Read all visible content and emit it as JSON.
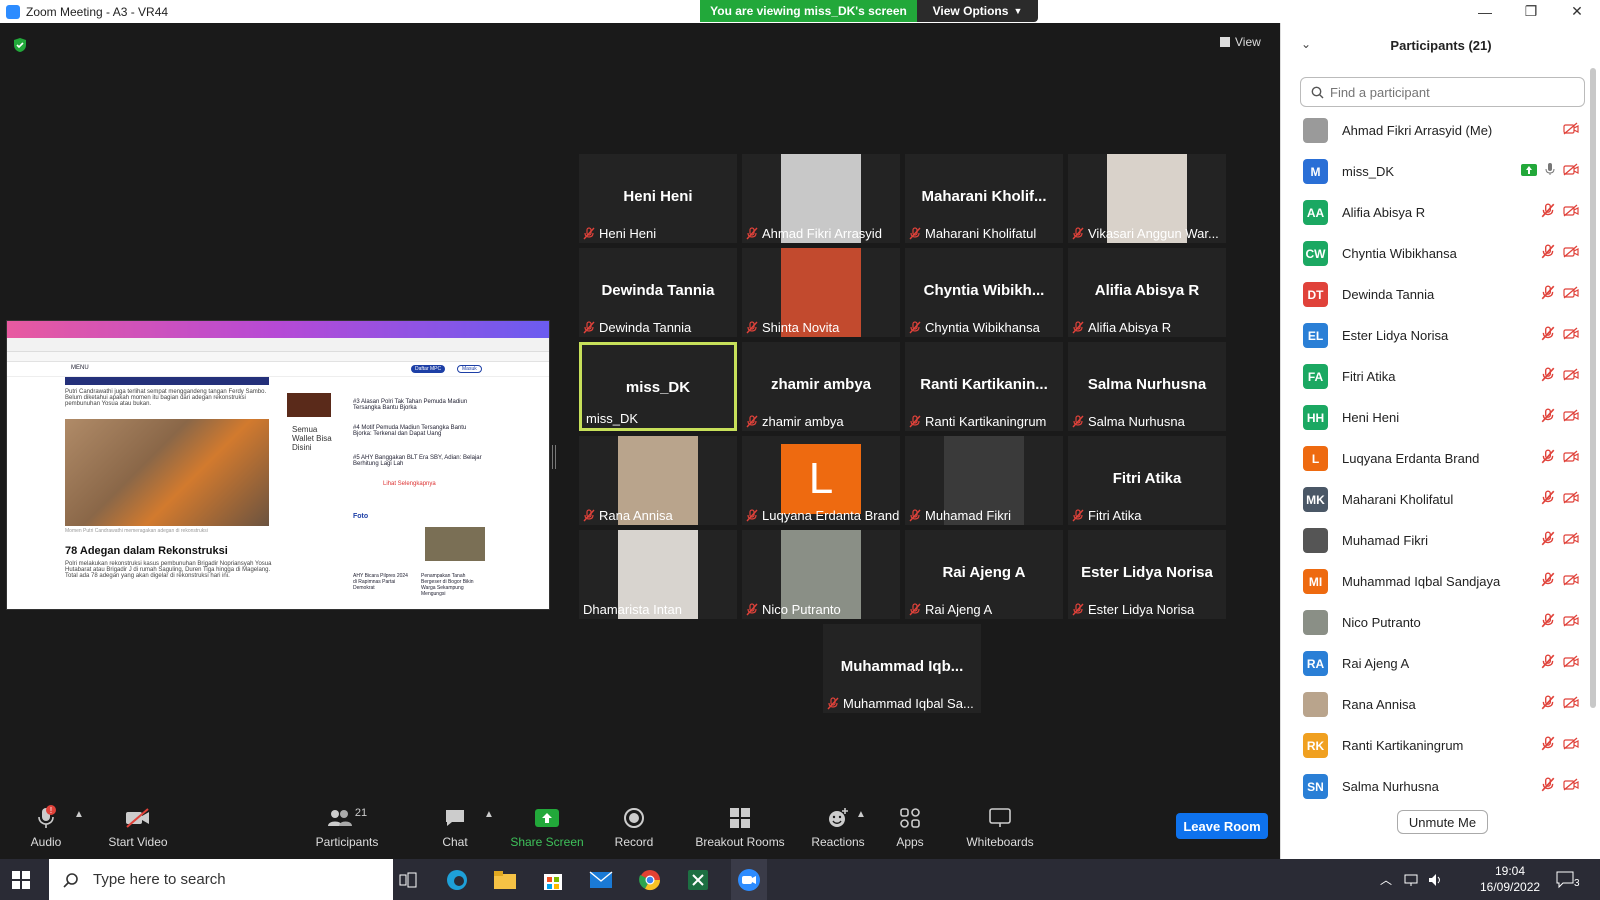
{
  "window": {
    "title": "Zoom Meeting - A3 - VR44",
    "minimize": "—",
    "maximize": "❐",
    "close": "✕"
  },
  "share_banner": {
    "text": "You are viewing miss_DK's screen",
    "view_options": "View Options"
  },
  "view_button": {
    "label": "View"
  },
  "shared_screen": {
    "headline": "78 Adegan dalam Rekonstruksi",
    "para1": "Putri Candrawathi juga terlihat sempat menggandeng tangan Ferdy Sambo. Belum diketahui apakah momen itu bagian dari adegan rekonstruksi pembunuhan Yosua atau bukan.",
    "para2": "Polri melakukan rekonstruksi kasus pembunuhan Brigadir Nopriansyah Yosua Hutabarat atau Brigadir J di rumah Saguling, Duren Tiga hingga di Magelang. Total ada 78 adegan yang akan digelar di rekonstruksi hari ini.",
    "side_items": [
      "#3 Alasan Polri Tak Tahan Pemuda Madiun Tersangka Bantu Bjorka",
      "#4 Motif Pemuda Madiun Tersangka Bantu Bjorka: Terkenal dan Dapat Uang",
      "#5 AHY Banggakan BLT Era SBY, Adian: Belajar Berhitung Lagi Lah"
    ],
    "side_link": "Lihat Selengkapnya",
    "foto_label": "Foto",
    "wallet_text": "Semua Wallet Bisa Disini",
    "menu_label": "MENU",
    "daftar_label": "Daftar MPC",
    "masuk_label": "Masuk",
    "caption": "Momen Putri Candrawathi memeragakan adegan di rekonstruksi",
    "foto_item1": "AHY Bicara Pilpres 2024 di Rapimnas Partai Demokrat",
    "foto_item2": "Penampakan Tanah Bergeser di Bogor Bikin Warga Sekampung Mengungsi"
  },
  "tiles": [
    {
      "name": "Heni Heni",
      "label": "Heni Heni",
      "muted": true,
      "photo": false
    },
    {
      "name": "",
      "label": "Ahmad Fikri Arrasyid",
      "muted": true,
      "photo": true,
      "photo_color": "#c8c8c8"
    },
    {
      "name": "Maharani Kholif...",
      "label": "Maharani Kholifatul",
      "muted": true,
      "photo": false
    },
    {
      "name": "",
      "label": "Vikasari Anggun War...",
      "muted": true,
      "photo": true,
      "photo_color": "#d9d2ca"
    },
    {
      "name": "Dewinda Tannia",
      "label": "Dewinda Tannia",
      "muted": true,
      "photo": false
    },
    {
      "name": "",
      "label": "Shinta Novita",
      "muted": true,
      "photo": true,
      "photo_color": "#c24a2e"
    },
    {
      "name": "Chyntia Wibikh...",
      "label": "Chyntia Wibikhansa",
      "muted": true,
      "photo": false
    },
    {
      "name": "Alifia Abisya R",
      "label": "Alifia Abisya R",
      "muted": true,
      "photo": false
    },
    {
      "name": "miss_DK",
      "label": "miss_DK",
      "muted": false,
      "photo": false,
      "active": true
    },
    {
      "name": "zhamir ambya",
      "label": "zhamir ambya",
      "muted": true,
      "photo": false
    },
    {
      "name": "Ranti Kartikanin...",
      "label": "Ranti Kartikaningrum",
      "muted": true,
      "photo": false
    },
    {
      "name": "Salma Nurhusna",
      "label": "Salma Nurhusna",
      "muted": true,
      "photo": false
    },
    {
      "name": "",
      "label": "Rana Annisa",
      "muted": true,
      "photo": true,
      "photo_color": "#b9a48c"
    },
    {
      "name": "",
      "label": "Luqyana Erdanta Brand",
      "muted": true,
      "photo": true,
      "photo_color": "#ee6a10",
      "letter": "L"
    },
    {
      "name": "",
      "label": "Muhamad Fikri",
      "muted": true,
      "photo": true,
      "photo_color": "#3a3a3a"
    },
    {
      "name": "Fitri Atika",
      "label": "Fitri Atika",
      "muted": true,
      "photo": false
    },
    {
      "name": "",
      "label": "Dhamarista Intan",
      "muted": false,
      "photo": true,
      "photo_color": "#d8d4cf"
    },
    {
      "name": "",
      "label": "Nico Putranto",
      "muted": true,
      "photo": true,
      "photo_color": "#8a8f86"
    },
    {
      "name": "Rai Ajeng A",
      "label": "Rai Ajeng A",
      "muted": true,
      "photo": false
    },
    {
      "name": "Ester Lidya Norisa",
      "label": "Ester Lidya Norisa",
      "muted": true,
      "photo": false
    },
    {
      "name": "Muhammad Iqb...",
      "label": "Muhammad Iqbal Sa...",
      "muted": true,
      "photo": false
    }
  ],
  "toolbar": {
    "audio": "Audio",
    "audio_badge": "!",
    "start_video": "Start Video",
    "participants": "Participants",
    "participants_count": "21",
    "chat": "Chat",
    "share_screen": "Share Screen",
    "record": "Record",
    "breakout_rooms": "Breakout Rooms",
    "reactions": "Reactions",
    "apps": "Apps",
    "whiteboards": "Whiteboards",
    "leave": "Leave Room"
  },
  "panel": {
    "title": "Participants (21)",
    "search_placeholder": "Find a participant",
    "unmute_button": "Unmute Me",
    "participants": [
      {
        "name": "Ahmad Fikri Arrasyid (Me)",
        "initials": "",
        "color": "#9a9a9a",
        "photo": true,
        "video_icon": false
      },
      {
        "name": "miss_DK",
        "initials": "M",
        "color": "#2a6fd6",
        "photo": false,
        "sharing": true,
        "mic_on": true
      },
      {
        "name": "Alifia Abisya R",
        "initials": "AA",
        "color": "#1ba862",
        "photo": false
      },
      {
        "name": "Chyntia Wibikhansa",
        "initials": "CW",
        "color": "#1ba862",
        "photo": false
      },
      {
        "name": "Dewinda Tannia",
        "initials": "DT",
        "color": "#e0423a",
        "photo": false
      },
      {
        "name": "Ester Lidya Norisa",
        "initials": "EL",
        "color": "#2a7fd6",
        "photo": false
      },
      {
        "name": "Fitri Atika",
        "initials": "FA",
        "color": "#1ba862",
        "photo": false
      },
      {
        "name": "Heni Heni",
        "initials": "HH",
        "color": "#1ba862",
        "photo": false
      },
      {
        "name": "Luqyana Erdanta Brand",
        "initials": "L",
        "color": "#ee6a10",
        "photo": false
      },
      {
        "name": "Maharani Kholifatul",
        "initials": "MK",
        "color": "#4a5766",
        "photo": false
      },
      {
        "name": "Muhamad Fikri",
        "initials": "",
        "color": "#555555",
        "photo": true
      },
      {
        "name": "Muhammad Iqbal Sandjaya",
        "initials": "MI",
        "color": "#ee6a10",
        "photo": false
      },
      {
        "name": "Nico Putranto",
        "initials": "",
        "color": "#8a8f86",
        "photo": true
      },
      {
        "name": "Rai Ajeng A",
        "initials": "RA",
        "color": "#2a7fd6",
        "photo": false
      },
      {
        "name": "Rana Annisa",
        "initials": "",
        "color": "#b9a48c",
        "photo": true
      },
      {
        "name": "Ranti Kartikaningrum",
        "initials": "RK",
        "color": "#f0a020",
        "photo": false
      },
      {
        "name": "Salma Nurhusna",
        "initials": "SN",
        "color": "#2a7fd6",
        "photo": false
      }
    ]
  },
  "taskbar": {
    "search_placeholder": "Type here to search",
    "time": "19:04",
    "date": "16/09/2022",
    "notification_count": "3"
  },
  "colors": {
    "accent": "#0e72ed",
    "share_green": "#22a83a",
    "mute_red": "#e0423a",
    "active_border": "#c7e05a"
  }
}
